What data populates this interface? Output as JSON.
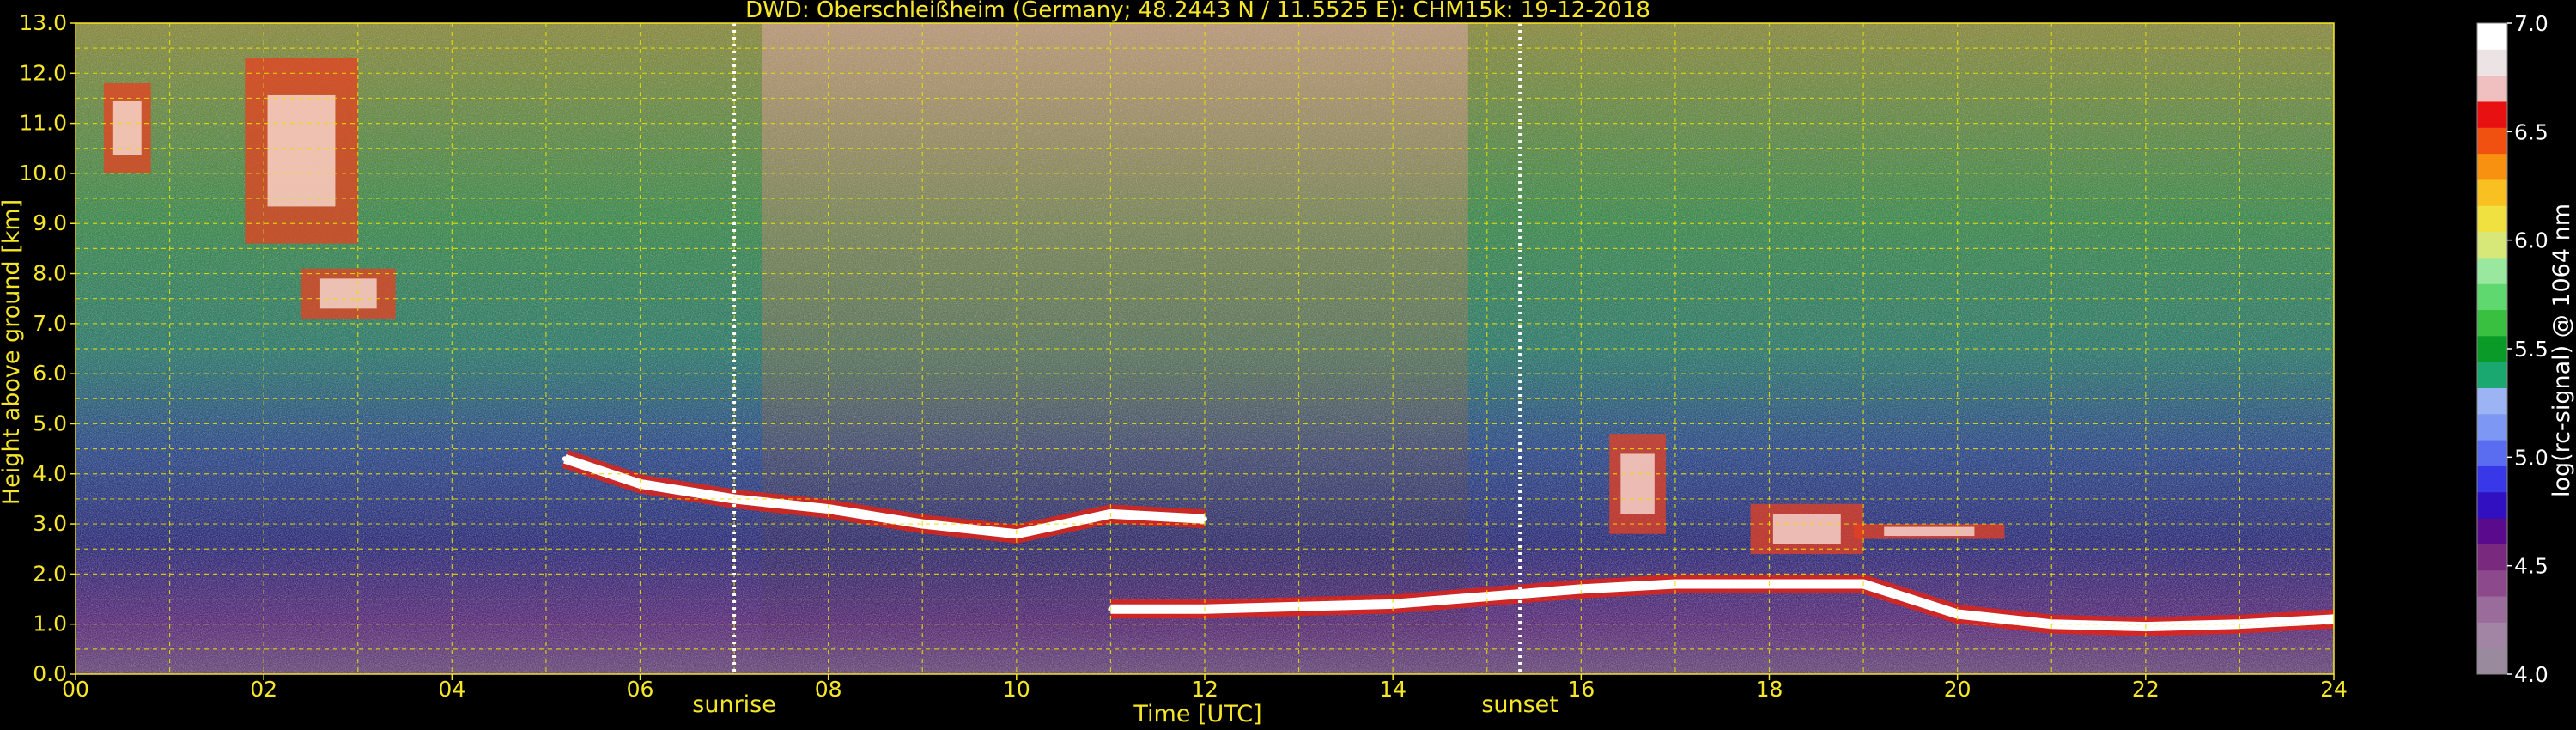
{
  "chart_data": {
    "type": "heatmap",
    "title": "DWD: Oberschleißheim (Germany; 48.2443 N / 11.5525 E):    CHM15k: 19-12-2018",
    "xlabel": "Time [UTC]",
    "ylabel": "Height above ground [km]",
    "xlim": [
      0,
      24
    ],
    "ylim": [
      0,
      13
    ],
    "x_ticks": [
      "00",
      "02",
      "04",
      "06",
      "08",
      "10",
      "12",
      "14",
      "16",
      "18",
      "20",
      "22",
      "24"
    ],
    "y_ticks": [
      "0.0",
      "1.0",
      "2.0",
      "3.0",
      "4.0",
      "5.0",
      "6.0",
      "7.0",
      "8.0",
      "9.0",
      "10.0",
      "11.0",
      "12.0",
      "13.0"
    ],
    "grid": true,
    "markers": [
      {
        "label": "sunrise",
        "x": 7.0
      },
      {
        "label": "sunset",
        "x": 15.35
      }
    ],
    "colorbar": {
      "label": "log(rc-signal) @ 1064 nm",
      "range": [
        4.0,
        7.0
      ],
      "ticks": [
        "4.0",
        "4.5",
        "5.0",
        "5.5",
        "6.0",
        "6.5",
        "7.0"
      ],
      "colors": [
        "#9a8a9e",
        "#a285a4",
        "#9a6c9c",
        "#8c4a8c",
        "#7a2a7e",
        "#5a0a8c",
        "#3010c0",
        "#3838e8",
        "#5a6cf0",
        "#7c98f4",
        "#9cb4f4",
        "#1aa870",
        "#0a9a28",
        "#3ac040",
        "#60d870",
        "#9ae8a0",
        "#d8e878",
        "#f0e040",
        "#f8c020",
        "#f89010",
        "#f05010",
        "#e81010",
        "#f0c0c0",
        "#ece4e4",
        "#ffffff"
      ]
    },
    "layers": [
      {
        "name": "cirrus",
        "segments": [
          [
            0.3,
            0.8,
            10.0,
            11.8
          ],
          [
            1.8,
            3.0,
            8.6,
            12.3
          ],
          [
            2.4,
            3.4,
            7.1,
            8.1
          ]
        ]
      },
      {
        "name": "mid_cloud_base",
        "points": [
          [
            5.2,
            4.3
          ],
          [
            6.0,
            3.8
          ],
          [
            7.0,
            3.5
          ],
          [
            8.0,
            3.3
          ],
          [
            9.0,
            3.0
          ],
          [
            10.0,
            2.8
          ],
          [
            11.0,
            3.2
          ],
          [
            12.0,
            3.1
          ]
        ]
      },
      {
        "name": "low_cloud_base",
        "points": [
          [
            11.0,
            1.3
          ],
          [
            12.0,
            1.3
          ],
          [
            13.0,
            1.35
          ],
          [
            14.0,
            1.4
          ],
          [
            15.0,
            1.55
          ],
          [
            16.0,
            1.7
          ],
          [
            17.0,
            1.8
          ],
          [
            18.0,
            1.8
          ],
          [
            19.0,
            1.8
          ],
          [
            20.0,
            1.2
          ],
          [
            21.0,
            1.0
          ],
          [
            22.0,
            0.95
          ],
          [
            23.0,
            1.0
          ],
          [
            24.0,
            1.1
          ]
        ]
      },
      {
        "name": "cloud_patches",
        "segments": [
          [
            16.3,
            16.9,
            2.8,
            4.8
          ],
          [
            17.8,
            19.0,
            2.4,
            3.4
          ],
          [
            18.9,
            20.5,
            2.7,
            3.0
          ]
        ]
      }
    ]
  }
}
